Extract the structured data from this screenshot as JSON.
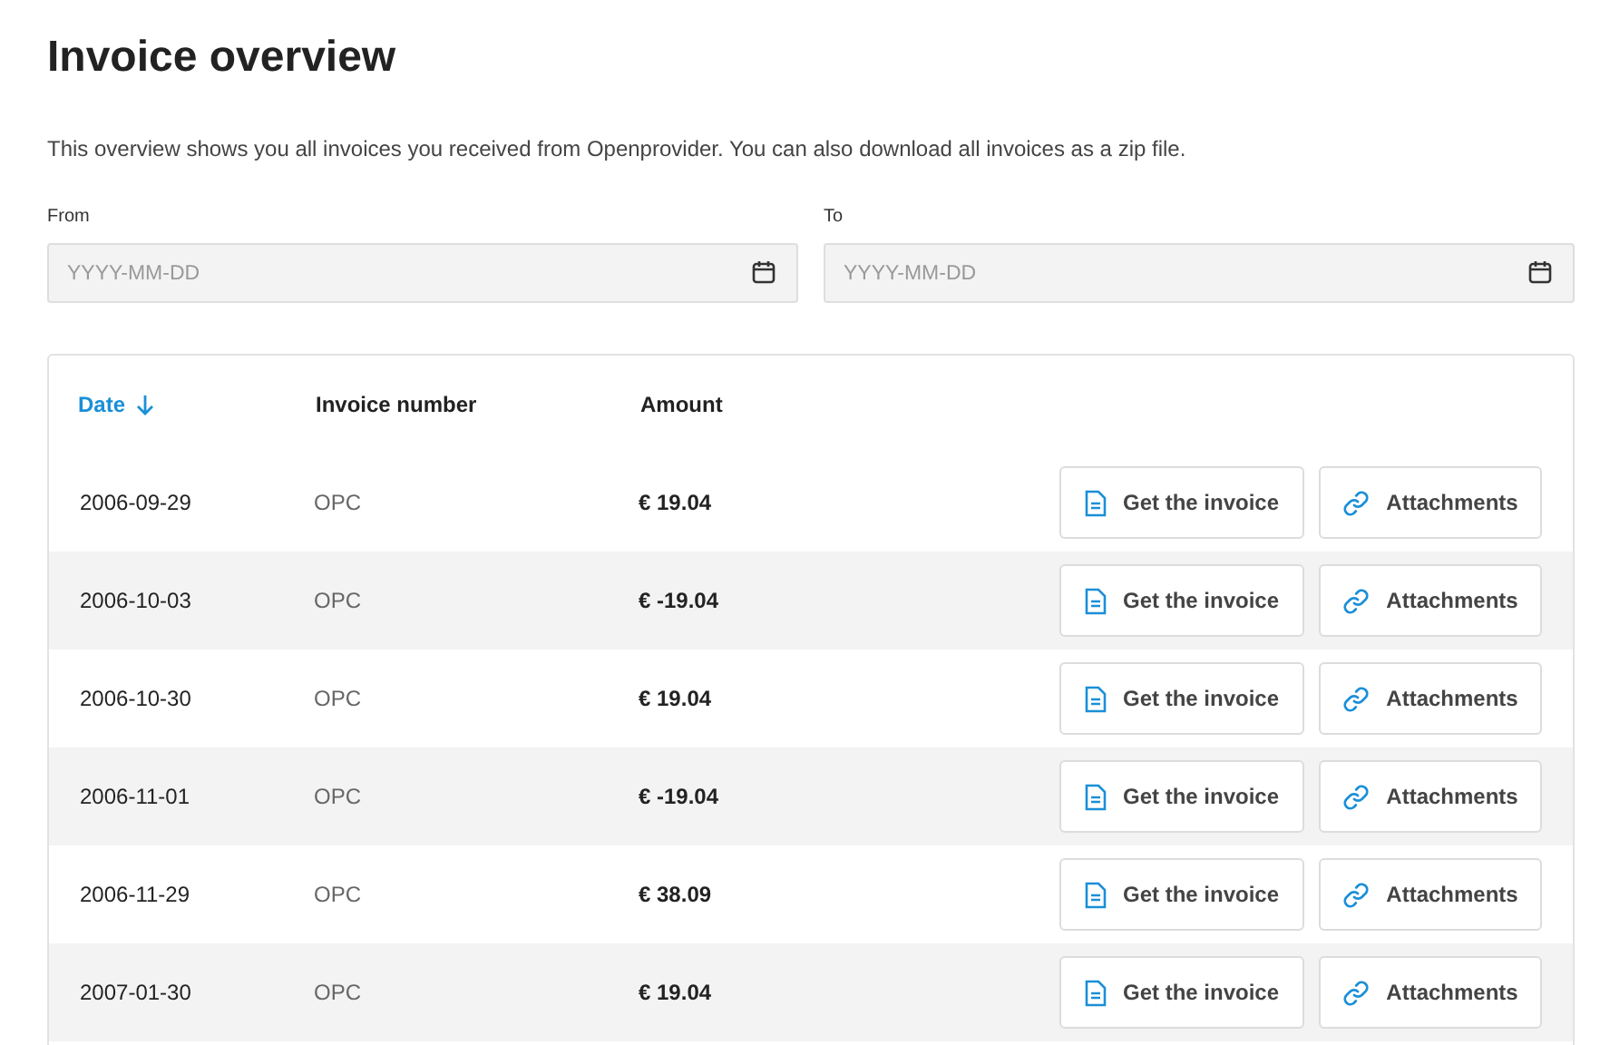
{
  "title": "Invoice overview",
  "description": "This overview shows you all invoices you received from Openprovider. You can also download all invoices as a zip file.",
  "filters": [
    {
      "label": "From",
      "placeholder": "YYYY-MM-DD"
    },
    {
      "label": "To",
      "placeholder": "YYYY-MM-DD"
    }
  ],
  "table": {
    "columns": [
      {
        "label": "Date",
        "sorted": true
      },
      {
        "label": "Invoice number",
        "sorted": false
      },
      {
        "label": "Amount",
        "sorted": false
      }
    ],
    "rows": [
      {
        "date": "2006-09-29",
        "invoice_number": "OPC",
        "amount": "€ 19.04",
        "buttons": [
          {
            "kind": "invoice",
            "label": "Get the invoice"
          },
          {
            "kind": "attachments",
            "label": "Attachments"
          }
        ]
      },
      {
        "date": "2006-10-03",
        "invoice_number": "OPC",
        "amount": "€ -19.04",
        "buttons": [
          {
            "kind": "invoice",
            "label": "Get the invoice"
          },
          {
            "kind": "attachments",
            "label": "Attachments"
          }
        ]
      },
      {
        "date": "2006-10-30",
        "invoice_number": "OPC",
        "amount": "€ 19.04",
        "buttons": [
          {
            "kind": "invoice",
            "label": "Get the invoice"
          },
          {
            "kind": "attachments",
            "label": "Attachments"
          }
        ]
      },
      {
        "date": "2006-11-01",
        "invoice_number": "OPC",
        "amount": "€ -19.04",
        "buttons": [
          {
            "kind": "invoice",
            "label": "Get the invoice"
          },
          {
            "kind": "attachments",
            "label": "Attachments"
          }
        ]
      },
      {
        "date": "2006-11-29",
        "invoice_number": "OPC",
        "amount": "€ 38.09",
        "buttons": [
          {
            "kind": "invoice",
            "label": "Get the invoice"
          },
          {
            "kind": "attachments",
            "label": "Attachments"
          }
        ]
      },
      {
        "date": "2007-01-30",
        "invoice_number": "OPC",
        "amount": "€ 19.04",
        "buttons": [
          {
            "kind": "invoice",
            "label": "Get the invoice"
          },
          {
            "kind": "attachments",
            "label": "Attachments"
          }
        ]
      }
    ]
  }
}
